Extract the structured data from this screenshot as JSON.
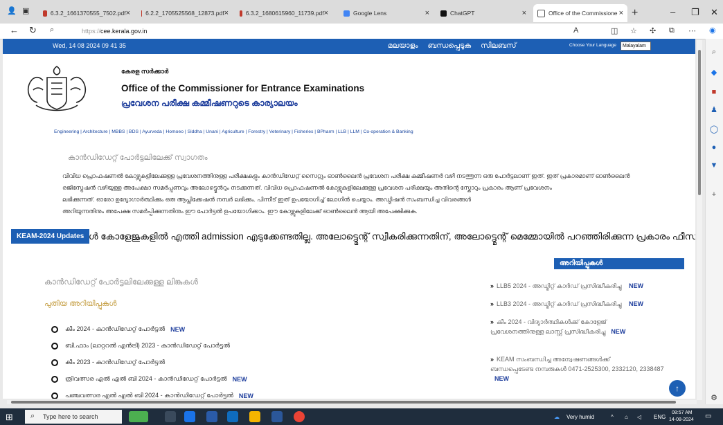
{
  "browser": {
    "tabs": [
      {
        "label": "6.3.2_1661370555_7502.pdf",
        "favicon_color": "#c0392b"
      },
      {
        "label": "6.2.2_1705525568_12873.pdf",
        "favicon_color": "#c0392b"
      },
      {
        "label": "6.3.2_1680615960_11739.pdf",
        "favicon_color": "#c0392b"
      },
      {
        "label": "Google Lens",
        "favicon_color": "#4285f4"
      },
      {
        "label": "ChatGPT",
        "favicon_color": "#111111"
      },
      {
        "label": "Office of the Commissione",
        "favicon_color": "#555555"
      }
    ],
    "url": "cee.kerala.gov.in",
    "url_prefix": "https://"
  },
  "site": {
    "date": "Wed, 14 08 2024 09 41 35",
    "top_links": [
      "മലയാളം",
      "ബന്ധപ്പെടുക",
      "സിലബസ്"
    ],
    "language_label": "Choose Your Language",
    "language_value": "Malayalam",
    "govt_name": "കേരള സർക്കാർ",
    "office_en": "Office of the Commissioner for Entrance Examinations",
    "office_ml": "പ്രവേശന പരീക്ഷ കമ്മീഷണറുടെ കാര്യാലയം",
    "courses": "Engineering | Architecture | MBBS | BDS | Ayurveda | Homoeo | Siddha | Unani | Agriculture | Forestry | Veterinary | Fisheries | BPharm | LLB | LLM | Co-operation & Banking",
    "welcome": "കാൻഡിഡേറ്റ് പോർട്ടലിലേക്ക് സ്വാഗതം",
    "intro_lines": [
      "വിവിധ പ്രൊഫഷണൽ കോഴ്സുകളിലേക്കുള്ള പ്രവേശനത്തിനുള്ള പരീക്ഷകളും കാൻഡിഡേറ്റ് സൈറ്റും ഓൺലൈൻ പ്രവേശന പരീക്ഷ കമ്മീഷണർ വഴി നടത്തുന്ന ഒരു പോർട്ടലാണ് ഇത്. ഇത് പ്രകാരമാണ് ഓൺലൈൻ",
      "രജിസ്ട്രേഷൻ വഴിയുള്ള അപേക്ഷാ സമർപ്പണവും അലോട്ട്മെൻറും നടക്കുന്നത്. വിവിധ പ്രൊഫഷണൽ കോഴ്സുകളിലേക്കുള്ള പ്രവേശന പരീക്ഷയും അതിന്റെ സ്കോറും പ്രകാരം ആണ് പ്രവേശനം",
      "ലഭിക്കുന്നത്. ഓരോ ഉദ്യോഗാർത്ഥിക്കും ഒരു ആപ്ലിക്കേഷൻ നമ്പർ ലഭിക്കും. പിന്നീട് ഇത് ഉപയോഗിച്ച് ലോഗിൻ ചെയ്യാം. അഡ്മിഷൻ സംബന്ധിച്ച വിവരങ്ങൾ",
      "അറിയുന്നതിനും അപേക്ഷ സമർപ്പിക്കുന്നതിനും ഈ പോർട്ടൽ ഉപയോഗിക്കാം. ഈ കോഴ്സുകളിലേക്ക് ഓൺലൈൻ ആയി അപേക്ഷിക്കുക."
    ],
    "keam_badge": "KEAM-2024 Updates",
    "keam_marquee": "ൾ കോളേജുകളിൽ എത്തി admission എടുക്കേണ്ടതില്ല. അലോട്ട്മെന്റ് സ്വീകരിക്കുന്നതിന്, അലോട്ട്മെന്റ് മെമ്മോയിൽ പറഞ്ഞിരിക്കുന്ന പ്രകാരം ഫീസ് അടയ",
    "announcements_heading": "അറിയിപ്പുകൾ",
    "list_heading": "കാൻഡിഡേറ്റ് പോർട്ടലിലേക്കുള്ള ലിങ്കുകൾ",
    "sub_heading": "പുതിയ അറിയിപ്പുകൾ",
    "new_label": "NEW",
    "links": [
      {
        "text": "കീം 2024 - കാൻഡിഡേറ്റ് പോർട്ടൽ",
        "new": true
      },
      {
        "text": "ബി.ഫാം (ലാറ്ററൽ എൻട്രി) 2023 - കാൻഡിഡേറ്റ് പോർട്ടൽ",
        "new": false
      },
      {
        "text": "കീം 2023 - കാൻഡിഡേറ്റ് പോർട്ടൽ",
        "new": false
      },
      {
        "text": "ത്രിവത്സര എൽ എൽ ബി 2024 - കാൻഡിഡേറ്റ് പോർട്ടൽ",
        "new": true
      },
      {
        "text": "പഞ്ചവത്സര എൽ എൽ ബി 2024 - കാൻഡിഡേറ്റ് പോർട്ടൽ",
        "new": true
      }
    ],
    "announcements": [
      {
        "lines": [
          "LLB5 2024 - അഡ്മിറ്റ് കാർഡ് പ്രസിദ്ധീകരിച്ചു"
        ],
        "new": true
      },
      {
        "lines": [
          "LLB3 2024 - അഡ്മിറ്റ് കാർഡ് പ്രസിദ്ധീകരിച്ചു"
        ],
        "new": true
      },
      {
        "lines": [
          "കീം 2024 - വിദ്യാർത്ഥികൾക്ക് കോളേജ്",
          "പ്രവേശനത്തിനുള്ള ലാസ്റ്റ് പ്രസിദ്ധീകരിച്ചു"
        ],
        "new": true
      },
      {
        "lines": [
          "KEAM സംബന്ധിച്ച അന്വേഷണങ്ങൾക്ക്",
          "ബന്ധപ്പെടേണ്ട നമ്പരുകൾ 0471-2525300, 2332120, 2338487"
        ],
        "new": true
      }
    ]
  },
  "taskbar": {
    "search_placeholder": "Type here to search",
    "weather": "Very humid",
    "time": "08:57 AM",
    "date": "14-08-2024",
    "lang": "ENG"
  }
}
